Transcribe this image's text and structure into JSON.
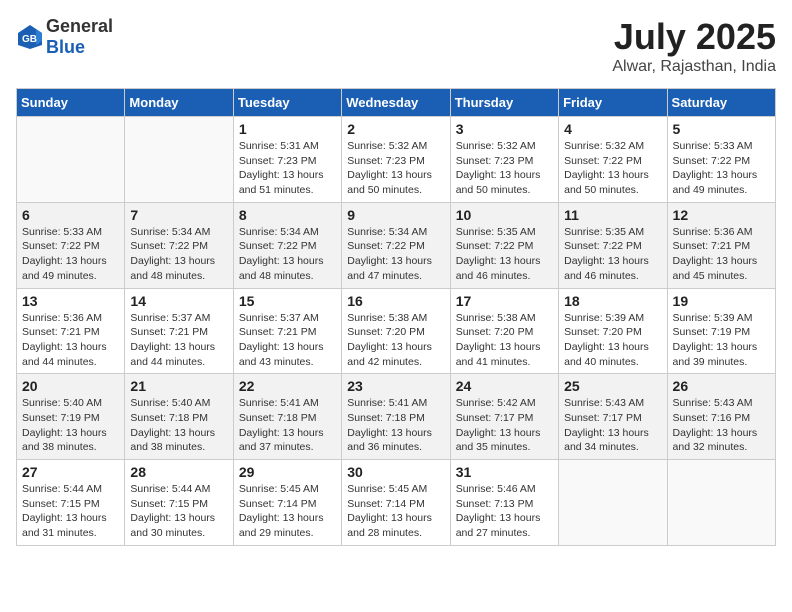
{
  "header": {
    "logo_general": "General",
    "logo_blue": "Blue",
    "month_year": "July 2025",
    "location": "Alwar, Rajasthan, India"
  },
  "weekdays": [
    "Sunday",
    "Monday",
    "Tuesday",
    "Wednesday",
    "Thursday",
    "Friday",
    "Saturday"
  ],
  "weeks": [
    [
      {
        "day": "",
        "info": ""
      },
      {
        "day": "",
        "info": ""
      },
      {
        "day": "1",
        "info": "Sunrise: 5:31 AM\nSunset: 7:23 PM\nDaylight: 13 hours and 51 minutes."
      },
      {
        "day": "2",
        "info": "Sunrise: 5:32 AM\nSunset: 7:23 PM\nDaylight: 13 hours and 50 minutes."
      },
      {
        "day": "3",
        "info": "Sunrise: 5:32 AM\nSunset: 7:23 PM\nDaylight: 13 hours and 50 minutes."
      },
      {
        "day": "4",
        "info": "Sunrise: 5:32 AM\nSunset: 7:22 PM\nDaylight: 13 hours and 50 minutes."
      },
      {
        "day": "5",
        "info": "Sunrise: 5:33 AM\nSunset: 7:22 PM\nDaylight: 13 hours and 49 minutes."
      }
    ],
    [
      {
        "day": "6",
        "info": "Sunrise: 5:33 AM\nSunset: 7:22 PM\nDaylight: 13 hours and 49 minutes."
      },
      {
        "day": "7",
        "info": "Sunrise: 5:34 AM\nSunset: 7:22 PM\nDaylight: 13 hours and 48 minutes."
      },
      {
        "day": "8",
        "info": "Sunrise: 5:34 AM\nSunset: 7:22 PM\nDaylight: 13 hours and 48 minutes."
      },
      {
        "day": "9",
        "info": "Sunrise: 5:34 AM\nSunset: 7:22 PM\nDaylight: 13 hours and 47 minutes."
      },
      {
        "day": "10",
        "info": "Sunrise: 5:35 AM\nSunset: 7:22 PM\nDaylight: 13 hours and 46 minutes."
      },
      {
        "day": "11",
        "info": "Sunrise: 5:35 AM\nSunset: 7:22 PM\nDaylight: 13 hours and 46 minutes."
      },
      {
        "day": "12",
        "info": "Sunrise: 5:36 AM\nSunset: 7:21 PM\nDaylight: 13 hours and 45 minutes."
      }
    ],
    [
      {
        "day": "13",
        "info": "Sunrise: 5:36 AM\nSunset: 7:21 PM\nDaylight: 13 hours and 44 minutes."
      },
      {
        "day": "14",
        "info": "Sunrise: 5:37 AM\nSunset: 7:21 PM\nDaylight: 13 hours and 44 minutes."
      },
      {
        "day": "15",
        "info": "Sunrise: 5:37 AM\nSunset: 7:21 PM\nDaylight: 13 hours and 43 minutes."
      },
      {
        "day": "16",
        "info": "Sunrise: 5:38 AM\nSunset: 7:20 PM\nDaylight: 13 hours and 42 minutes."
      },
      {
        "day": "17",
        "info": "Sunrise: 5:38 AM\nSunset: 7:20 PM\nDaylight: 13 hours and 41 minutes."
      },
      {
        "day": "18",
        "info": "Sunrise: 5:39 AM\nSunset: 7:20 PM\nDaylight: 13 hours and 40 minutes."
      },
      {
        "day": "19",
        "info": "Sunrise: 5:39 AM\nSunset: 7:19 PM\nDaylight: 13 hours and 39 minutes."
      }
    ],
    [
      {
        "day": "20",
        "info": "Sunrise: 5:40 AM\nSunset: 7:19 PM\nDaylight: 13 hours and 38 minutes."
      },
      {
        "day": "21",
        "info": "Sunrise: 5:40 AM\nSunset: 7:18 PM\nDaylight: 13 hours and 38 minutes."
      },
      {
        "day": "22",
        "info": "Sunrise: 5:41 AM\nSunset: 7:18 PM\nDaylight: 13 hours and 37 minutes."
      },
      {
        "day": "23",
        "info": "Sunrise: 5:41 AM\nSunset: 7:18 PM\nDaylight: 13 hours and 36 minutes."
      },
      {
        "day": "24",
        "info": "Sunrise: 5:42 AM\nSunset: 7:17 PM\nDaylight: 13 hours and 35 minutes."
      },
      {
        "day": "25",
        "info": "Sunrise: 5:43 AM\nSunset: 7:17 PM\nDaylight: 13 hours and 34 minutes."
      },
      {
        "day": "26",
        "info": "Sunrise: 5:43 AM\nSunset: 7:16 PM\nDaylight: 13 hours and 32 minutes."
      }
    ],
    [
      {
        "day": "27",
        "info": "Sunrise: 5:44 AM\nSunset: 7:15 PM\nDaylight: 13 hours and 31 minutes."
      },
      {
        "day": "28",
        "info": "Sunrise: 5:44 AM\nSunset: 7:15 PM\nDaylight: 13 hours and 30 minutes."
      },
      {
        "day": "29",
        "info": "Sunrise: 5:45 AM\nSunset: 7:14 PM\nDaylight: 13 hours and 29 minutes."
      },
      {
        "day": "30",
        "info": "Sunrise: 5:45 AM\nSunset: 7:14 PM\nDaylight: 13 hours and 28 minutes."
      },
      {
        "day": "31",
        "info": "Sunrise: 5:46 AM\nSunset: 7:13 PM\nDaylight: 13 hours and 27 minutes."
      },
      {
        "day": "",
        "info": ""
      },
      {
        "day": "",
        "info": ""
      }
    ]
  ]
}
